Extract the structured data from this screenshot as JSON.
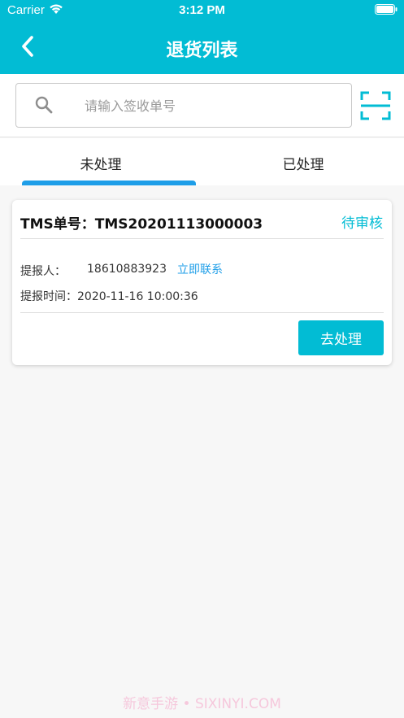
{
  "status_bar": {
    "carrier": "Carrier",
    "time": "3:12 PM"
  },
  "nav": {
    "title": "退货列表",
    "back_icon": "chevron-left-icon"
  },
  "search": {
    "placeholder": "请输入签收单号",
    "value": "",
    "icon": "search-icon",
    "scan_icon": "scan-icon"
  },
  "tabs": [
    {
      "label": "未处理",
      "active": true
    },
    {
      "label": "已处理",
      "active": false
    }
  ],
  "orders": [
    {
      "tms_label": "TMS单号：",
      "tms_number": "TMS20201113000003",
      "status": "待审核",
      "submitter_label": "提报人：",
      "submitter_phone": "18610883923",
      "contact_label": "立即联系",
      "time_label": "提报时间：",
      "time_value": "2020-11-16 10:00:36",
      "action_label": "去处理"
    }
  ],
  "watermark": "新意手游 • SIXINYI.COM",
  "colors": {
    "accent": "#02bcd4",
    "tab_underline": "#1e9ee8",
    "link": "#1e9ee8",
    "background": "#f7f7f7"
  }
}
